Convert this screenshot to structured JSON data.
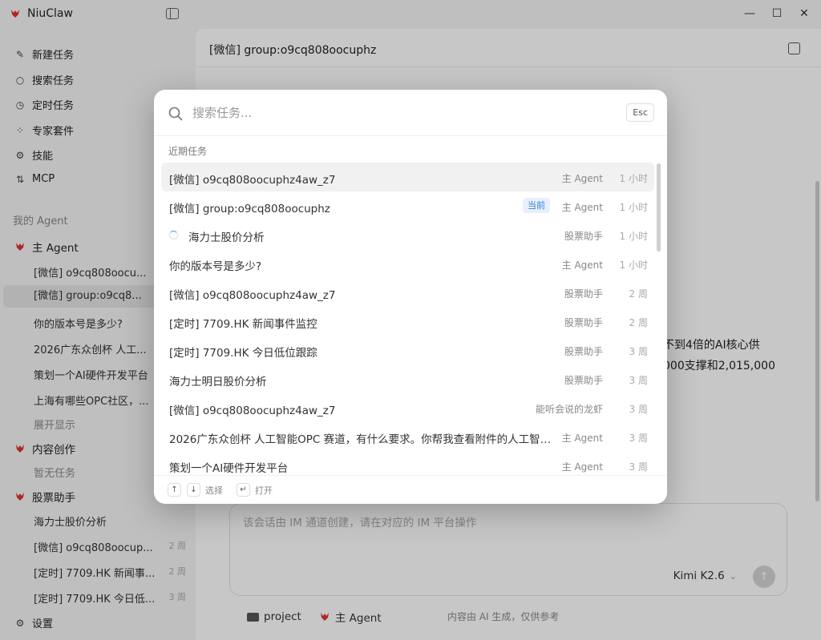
{
  "app": {
    "name": "NiuClaw",
    "brand_color": "#e0312d"
  },
  "window": {
    "minimize": "—",
    "maximize": "☐",
    "close": "✕"
  },
  "sidebar": {
    "nav": [
      {
        "label": "新建任务",
        "icon": "edit-icon"
      },
      {
        "label": "搜索任务",
        "icon": "search-icon"
      },
      {
        "label": "定时任务",
        "icon": "clock-icon"
      },
      {
        "label": "专家套件",
        "icon": "grid-icon"
      },
      {
        "label": "技能",
        "icon": "puzzle-icon"
      },
      {
        "label": "MCP",
        "icon": "plug-icon"
      }
    ],
    "my_agent_label": "我的 Agent",
    "main_agent": {
      "name": "主 Agent",
      "items": [
        "[微信] o9cq808oocu...",
        "[微信] group:o9cq8...",
        "你的版本号是多少?",
        "2026广东众创杯 人工...",
        "策划一个AI硬件开发平台",
        "上海有哪些OPC社区，..."
      ],
      "expand": "展开显示"
    },
    "content_agent": {
      "name": "内容创作",
      "empty": "暂无任务"
    },
    "stock_agent": {
      "name": "股票助手",
      "items": [
        {
          "label": "海力士股价分析",
          "time": ""
        },
        {
          "label": "[微信] o9cq808oocup...",
          "time": "2 周"
        },
        {
          "label": "[定时] 7709.HK 新闻事...",
          "time": "2 周"
        },
        {
          "label": "[定时] 7709.HK 今日低...",
          "time": "3 周"
        }
      ]
    },
    "settings": "设置"
  },
  "main": {
    "title": "[微信] group:o9cq808oocuphz",
    "bg_fragment_1": "不到4倍的AI核心供",
    "bg_fragment_2": "000支撑和2,015,000",
    "composer_placeholder": "该会话由 IM 通道创建，请在对应的 IM 平台操作",
    "model": "Kimi K2.6",
    "footer_project": "project",
    "footer_agent": "主 Agent",
    "footer_note": "内容由 AI 生成，仅供参考"
  },
  "palette": {
    "search_placeholder": "搜索任务...",
    "esc": "Esc",
    "recent_label": "近期任务",
    "rows": [
      {
        "title": "[微信] o9cq808oocuphz4aw_z7",
        "badge": "",
        "agent": "主 Agent",
        "time": "1 小时",
        "selected": true,
        "spinner": false
      },
      {
        "title": "[微信] group:o9cq808oocuphz",
        "badge": "当前",
        "agent": "主 Agent",
        "time": "1 小时",
        "selected": false,
        "spinner": false
      },
      {
        "title": "海力士股价分析",
        "badge": "",
        "agent": "股票助手",
        "time": "1 小时",
        "selected": false,
        "spinner": true
      },
      {
        "title": "你的版本号是多少?",
        "badge": "",
        "agent": "主 Agent",
        "time": "1 小时",
        "selected": false,
        "spinner": false
      },
      {
        "title": "[微信] o9cq808oocuphz4aw_z7",
        "badge": "",
        "agent": "股票助手",
        "time": "2 周",
        "selected": false,
        "spinner": false
      },
      {
        "title": "[定时] 7709.HK 新闻事件监控",
        "badge": "",
        "agent": "股票助手",
        "time": "2 周",
        "selected": false,
        "spinner": false
      },
      {
        "title": "[定时] 7709.HK 今日低位跟踪",
        "badge": "",
        "agent": "股票助手",
        "time": "3 周",
        "selected": false,
        "spinner": false
      },
      {
        "title": "海力士明日股价分析",
        "badge": "",
        "agent": "股票助手",
        "time": "3 周",
        "selected": false,
        "spinner": false
      },
      {
        "title": "[微信] o9cq808oocuphz4aw_z7",
        "badge": "",
        "agent": "能听会说的龙虾",
        "time": "3 周",
        "selected": false,
        "spinner": false
      },
      {
        "title": "2026广东众创杯 人工智能OPC 赛道，有什么要求。你帮我查看附件的人工智能...",
        "badge": "",
        "agent": "主 Agent",
        "time": "3 周",
        "selected": false,
        "spinner": false
      },
      {
        "title": "策划一个AI硬件开发平台",
        "badge": "",
        "agent": "主 Agent",
        "time": "3 周",
        "selected": false,
        "spinner": false
      }
    ],
    "footer": {
      "up": "↑",
      "down": "↓",
      "select": "选择",
      "enter": "↵",
      "open": "打开"
    }
  }
}
